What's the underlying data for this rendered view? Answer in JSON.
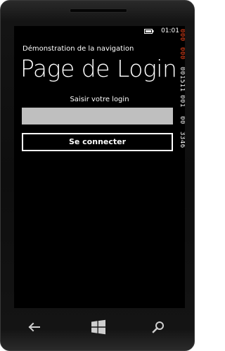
{
  "status_bar": {
    "time": "01:01",
    "battery_icon": "battery-icon"
  },
  "perf_counters": {
    "values": [
      "000",
      "000",
      "001511",
      "001",
      "00",
      "3346"
    ],
    "colors": [
      "#ff4a1f",
      "#ff4a1f",
      "#ffffff",
      "#ffffff",
      "#ffffff",
      "#ffffff"
    ]
  },
  "app": {
    "subtitle": "Démonstration de la navigation",
    "page_title": "Page de Login",
    "prompt_label": "Saisir votre login",
    "login_input": {
      "value": "",
      "placeholder": ""
    },
    "connect_button_label": "Se connecter"
  },
  "nav_bar": {
    "back_icon": "back-arrow-icon",
    "start_icon": "windows-logo-icon",
    "search_icon": "search-icon"
  }
}
